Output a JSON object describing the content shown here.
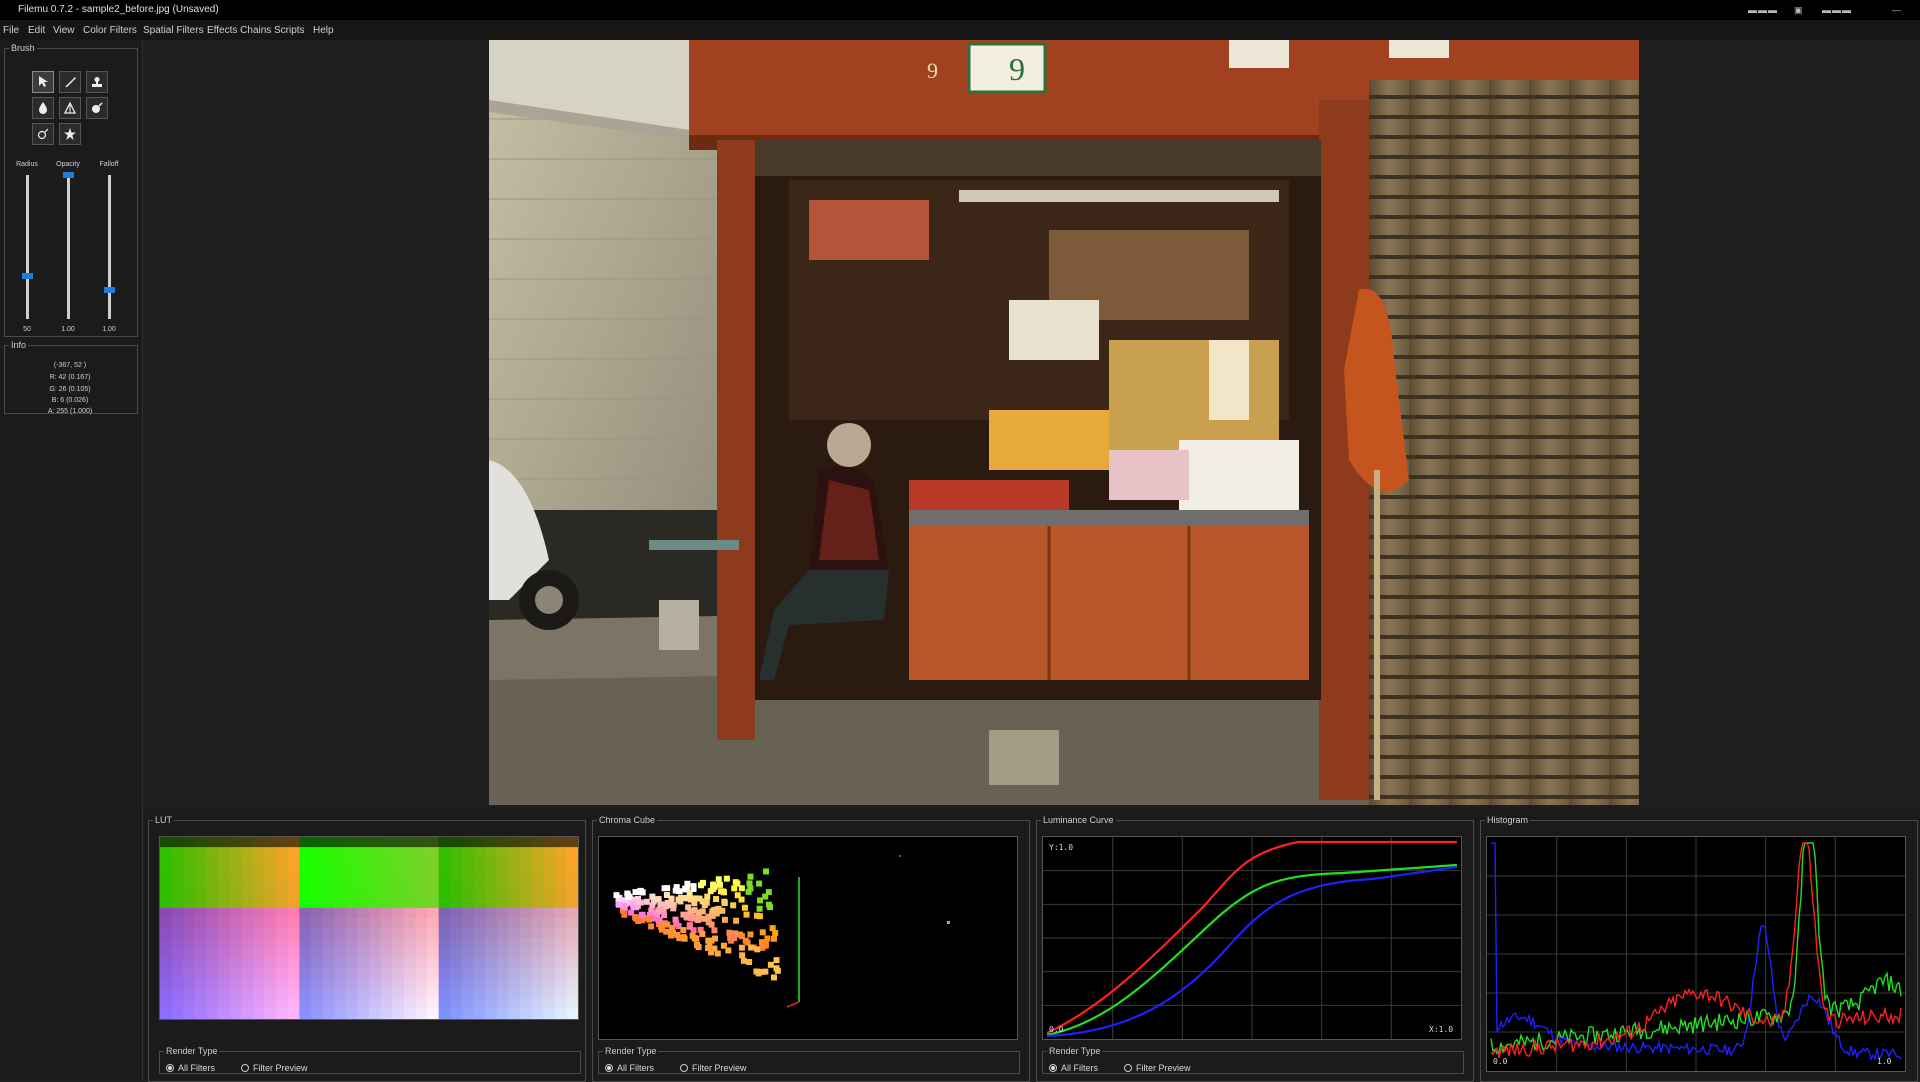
{
  "window": {
    "title": "Filemu 0.7.2 - sample2_before.jpg (Unsaved)"
  },
  "menu": [
    "File",
    "Edit",
    "View",
    "Color Filters",
    "Spatial Filters",
    "Effects Chains",
    "Scripts",
    "Help"
  ],
  "brush": {
    "group_label": "Brush",
    "tools": [
      "pointer-icon",
      "brush-icon",
      "stamp-icon",
      "drop-icon",
      "triangle-icon",
      "bucket-icon",
      "lasso-icon",
      "star-icon"
    ],
    "sliders": [
      {
        "label": "Radius",
        "value_text": "50",
        "level": 0.3
      },
      {
        "label": "Opacity",
        "value_text": "1.00",
        "level": 1.0
      },
      {
        "label": "Falloff",
        "value_text": "1.00",
        "level": 0.2
      }
    ]
  },
  "info": {
    "group_label": "Info",
    "lines": [
      "(-367, 52 )",
      "R: 42 (0.167)",
      "G: 26 (0.105)",
      "B: 6 (0.026)",
      "A: 255 (1.000)"
    ]
  },
  "panels": {
    "lut": {
      "title": "LUT"
    },
    "chroma": {
      "title": "Chroma Cube"
    },
    "luminance": {
      "title": "Luminance Curve",
      "y_label": "Y:1.0",
      "x_label": "X:1.0",
      "origin_label": "0.0"
    },
    "histogram": {
      "title": "Histogram",
      "origin_label": "0.0",
      "max_label": "1.0"
    }
  },
  "render_type": {
    "label": "Render Type",
    "options": [
      "All Filters",
      "Filter Preview"
    ],
    "selected": "All Filters"
  },
  "colors": {
    "accent": "#1a7fd8",
    "red": "#ff2020",
    "green": "#20e020",
    "blue": "#2020ff"
  }
}
